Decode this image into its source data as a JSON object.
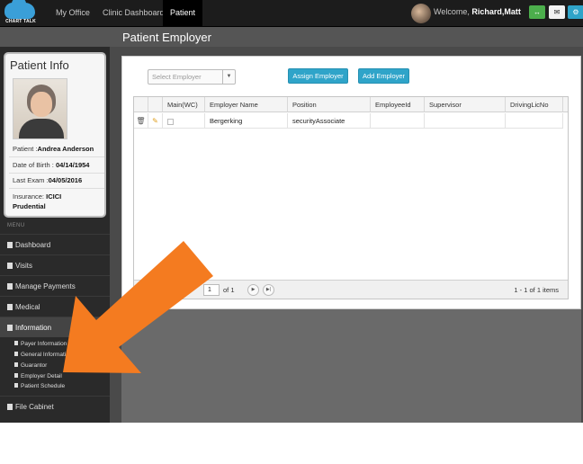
{
  "topbar": {
    "logo_text": "CHART TALK",
    "nav": [
      "My Office",
      "Clinic Dashboard",
      "Patient"
    ],
    "welcome_prefix": "Welcome, ",
    "welcome_user": "Richard,Matt"
  },
  "page": {
    "title": "Patient Employer"
  },
  "patient_info": {
    "title": "Patient Info",
    "name_label": "Patient :",
    "name": "Andrea Anderson",
    "dob_label": "Date of Birth : ",
    "dob": "04/14/1954",
    "last_exam_label": "Last Exam :",
    "last_exam": "04/05/2016",
    "insurance_label": "Insurance: ",
    "insurance": "ICICI Prudential"
  },
  "menu": {
    "header": "MENU",
    "items": [
      "Dashboard",
      "Visits",
      "Manage Payments",
      "Medical",
      "Information",
      "File Cabinet"
    ],
    "sub_items": [
      "Payer Information",
      "General Information",
      "Guarantor",
      "Employer Detail",
      "Patient Schedule"
    ]
  },
  "toolbar": {
    "select_placeholder": "Select Employer",
    "assign_label": "Assign Employer",
    "add_label": "Add Employer"
  },
  "grid": {
    "columns": [
      "Main(WC)",
      "Employer Name",
      "Position",
      "EmployeeId",
      "Supervisor",
      "DrivingLicNo"
    ],
    "rows": [
      {
        "employer_name": "Bergerking",
        "position": "securityAssociate",
        "employee_id": "",
        "supervisor": "",
        "driving_lic": ""
      }
    ],
    "pager": {
      "page": "1",
      "of": "of 1",
      "items": "1 - 1 of 1 items"
    }
  },
  "colors": {
    "accent": "#2fa4c9",
    "arrow": "#f47b20",
    "dark": "#2a2a2a"
  }
}
